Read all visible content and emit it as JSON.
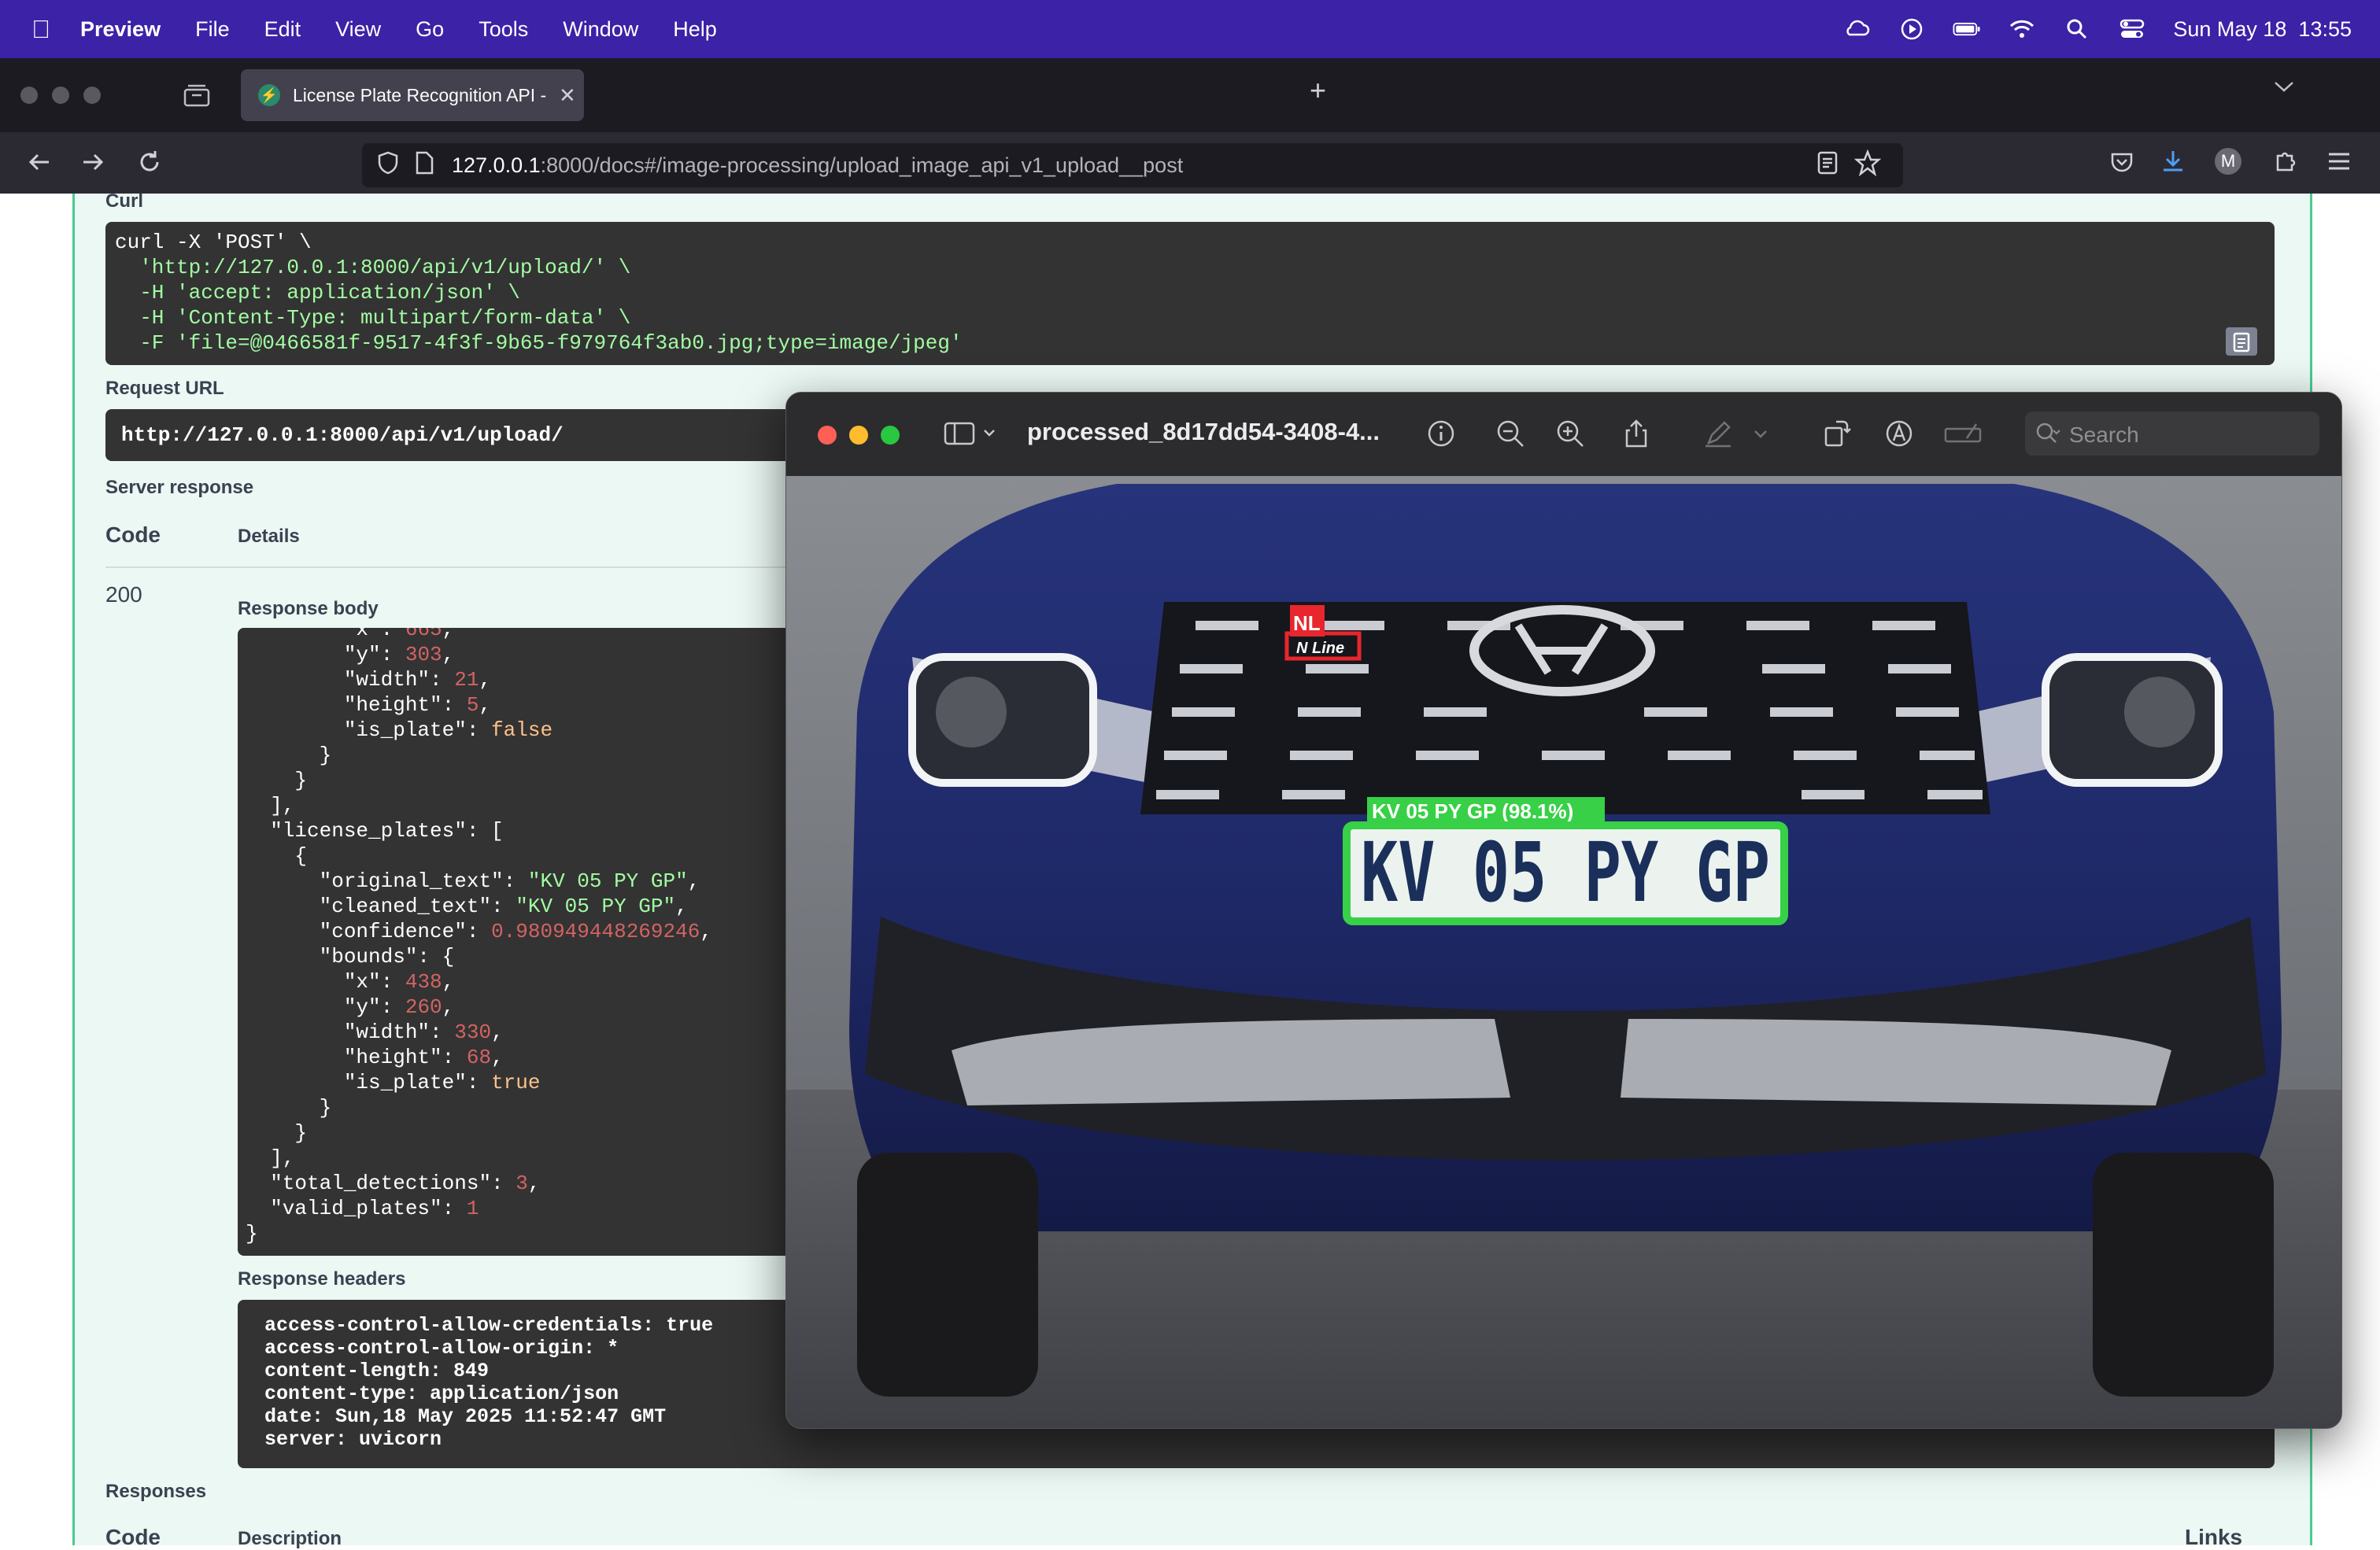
{
  "menubar": {
    "app": "Preview",
    "items": [
      "File",
      "Edit",
      "View",
      "Go",
      "Tools",
      "Window",
      "Help"
    ],
    "clock": "Sun May 18  13:55"
  },
  "browser": {
    "tab_title": "License Plate Recognition API -",
    "url_host": "127.0.0.1",
    "url_rest": ":8000/docs#/image-processing/upload_image_api_v1_upload__post"
  },
  "swagger": {
    "curl_label": "Curl",
    "curl_lines": [
      "curl -X 'POST' \\",
      "  'http://127.0.0.1:8000/api/v1/upload/' \\",
      "  -H 'accept: application/json' \\",
      "  -H 'Content-Type: multipart/form-data' \\",
      "  -F 'file=@0466581f-9517-4f3f-9b65-f979764f3ab0.jpg;type=image/jpeg'"
    ],
    "request_url_label": "Request URL",
    "request_url": "http://127.0.0.1:8000/api/v1/upload/",
    "server_response_label": "Server response",
    "code_header": "Code",
    "details_header": "Details",
    "status_code": "200",
    "response_body_label": "Response body",
    "response_headers_label": "Response headers",
    "response_headers": [
      "access-control-allow-credentials: true",
      "access-control-allow-origin: *",
      "content-length: 849",
      "content-type: application/json",
      "date: Sun,18 May 2025 11:52:47 GMT",
      "server: uvicorn"
    ],
    "responses_label": "Responses",
    "responses_code_header": "Code",
    "responses_desc_header": "Description",
    "responses_links_header": "Links"
  },
  "preview": {
    "title": "processed_8d17dd54-3408-4...",
    "search_placeholder": "Search",
    "detection_label": "KV 05 PY GP (98.1%)",
    "plate_text": "KV 05 PY GP",
    "small_box_label": "NL",
    "car_brand_text": "N Line"
  }
}
